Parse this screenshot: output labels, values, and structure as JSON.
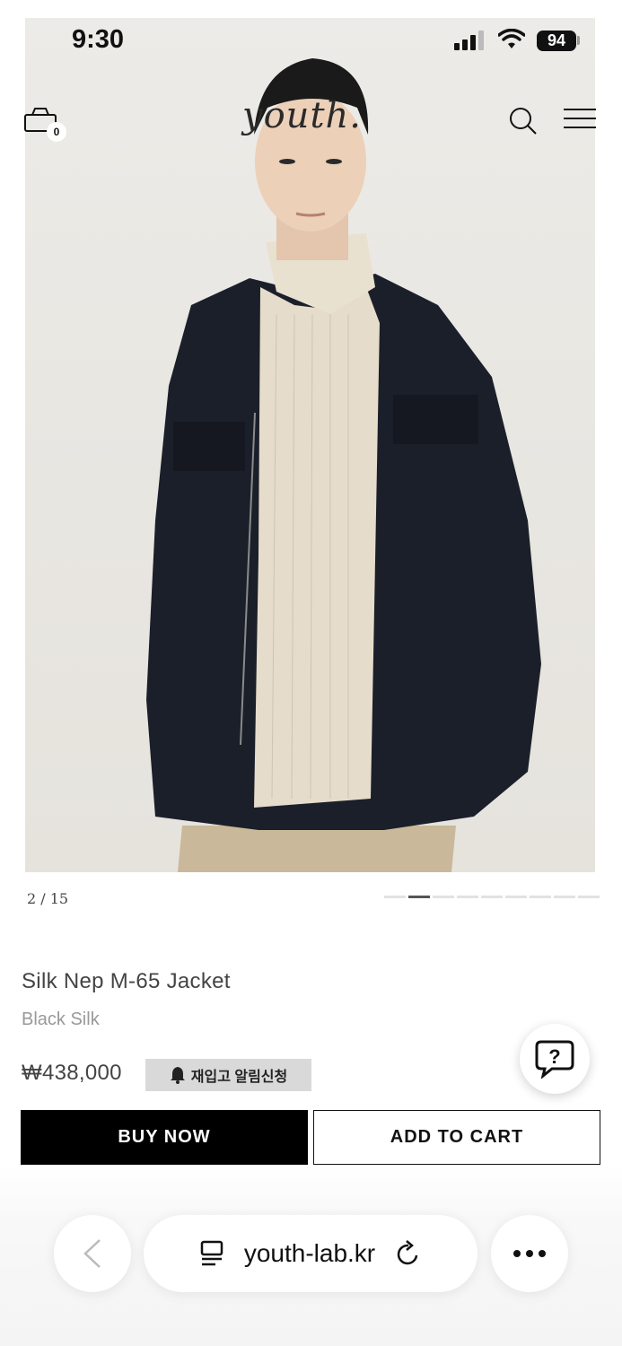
{
  "status_bar": {
    "time": "9:30",
    "battery": "94"
  },
  "header": {
    "logo": "youth.",
    "cart_count": "0"
  },
  "gallery": {
    "counter": "2 / 15",
    "total_images": 9,
    "active_index": 1
  },
  "product": {
    "name": "Silk Nep M-65 Jacket",
    "color": "Black Silk",
    "price": "₩438,000",
    "restock_label": "재입고 알림신청"
  },
  "actions": {
    "buy_now": "BUY NOW",
    "add_to_cart": "ADD TO CART"
  },
  "browser": {
    "url": "youth-lab.kr"
  },
  "colors": {
    "primary": "#000000",
    "accent_bg": "#d9d9d9",
    "image_bg": "#ecebe7"
  }
}
